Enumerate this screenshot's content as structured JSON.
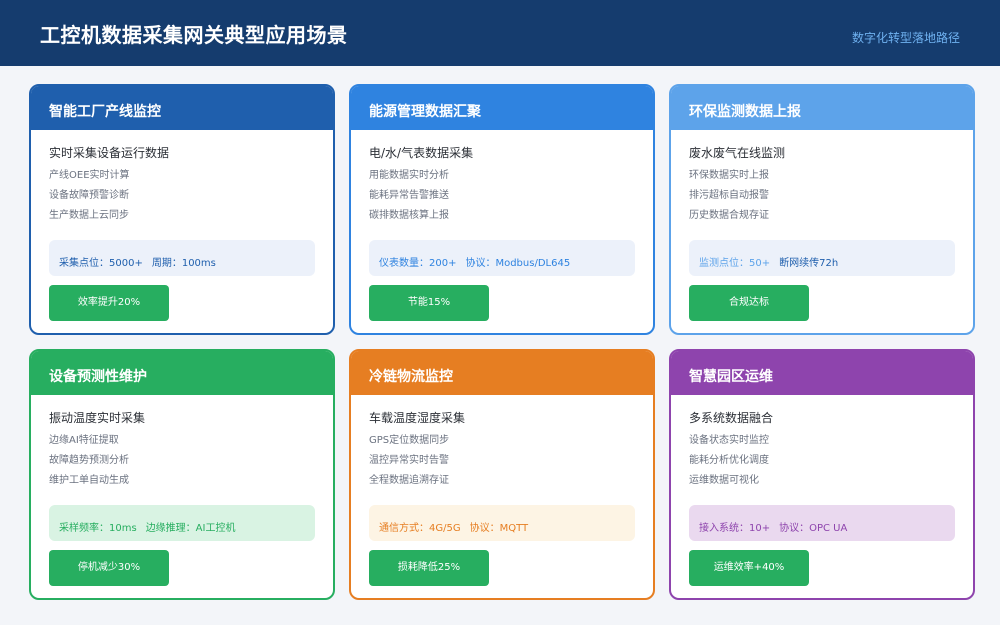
{
  "header": {
    "title": "工控机数据采集网关典型应用场景",
    "subtitle": "数字化转型落地路径"
  },
  "colors": {
    "header_bg": "#153c6e",
    "button": "#27ae60"
  },
  "cards": [
    {
      "title": "智能工厂产线监控",
      "subtitle": "实时采集设备运行数据",
      "items": [
        "产线OEE实时计算",
        "设备故障预警诊断",
        "生产数据上云同步"
      ],
      "info1": "采集点位：5000+",
      "info2": "周期：100ms",
      "button": "效率提升20%",
      "accent": "#1f5fad",
      "info_bg": "#ecf1fa",
      "info_color": "#1f5fad"
    },
    {
      "title": "能源管理数据汇聚",
      "subtitle": "电/水/气表数据采集",
      "items": [
        "用能数据实时分析",
        "能耗异常告警推送",
        "碳排数据核算上报"
      ],
      "info1": "仪表数量：200+",
      "info2": "协议：Modbus/DL645",
      "button": "节能15%",
      "accent": "#2f83e0",
      "info_bg": "#ecf1fa",
      "info_color": "#2f83e0"
    },
    {
      "title": "环保监测数据上报",
      "subtitle": "废水废气在线监测",
      "items": [
        "环保数据实时上报",
        "排污超标自动报警",
        "历史数据合规存证"
      ],
      "info1": "监测点位：50+",
      "info2": "断网续传72h",
      "button": "合规达标",
      "accent": "#5da3ea",
      "info_bg": "#ecf1fa",
      "info_color": "#5da3ea",
      "info2_color": "#1f5fad"
    },
    {
      "title": "设备预测性维护",
      "subtitle": "振动温度实时采集",
      "items": [
        "边缘AI特征提取",
        "故障趋势预测分析",
        "维护工单自动生成"
      ],
      "info1": "采样频率：10ms",
      "info2": "边缘推理：AI工控机",
      "button": "停机减少30%",
      "accent": "#27ae60",
      "info_bg": "#d9f3e3",
      "info_color": "#27ae60"
    },
    {
      "title": "冷链物流监控",
      "subtitle": "车载温度湿度采集",
      "items": [
        "GPS定位数据同步",
        "温控异常实时告警",
        "全程数据追溯存证"
      ],
      "info1": "通信方式：4G/5G",
      "info2": "协议：MQTT",
      "button": "损耗降低25%",
      "accent": "#e67e22",
      "info_bg": "#fdf4e4",
      "info_color": "#e67e22"
    },
    {
      "title": "智慧园区运维",
      "subtitle": "多系统数据融合",
      "items": [
        "设备状态实时监控",
        "能耗分析优化调度",
        "运维数据可视化"
      ],
      "info1": "接入系统：10+",
      "info2": "协议：OPC UA",
      "button": "运维效率+40%",
      "accent": "#8e44ad",
      "info_bg": "#ead9ef",
      "info_color": "#8e44ad"
    }
  ]
}
